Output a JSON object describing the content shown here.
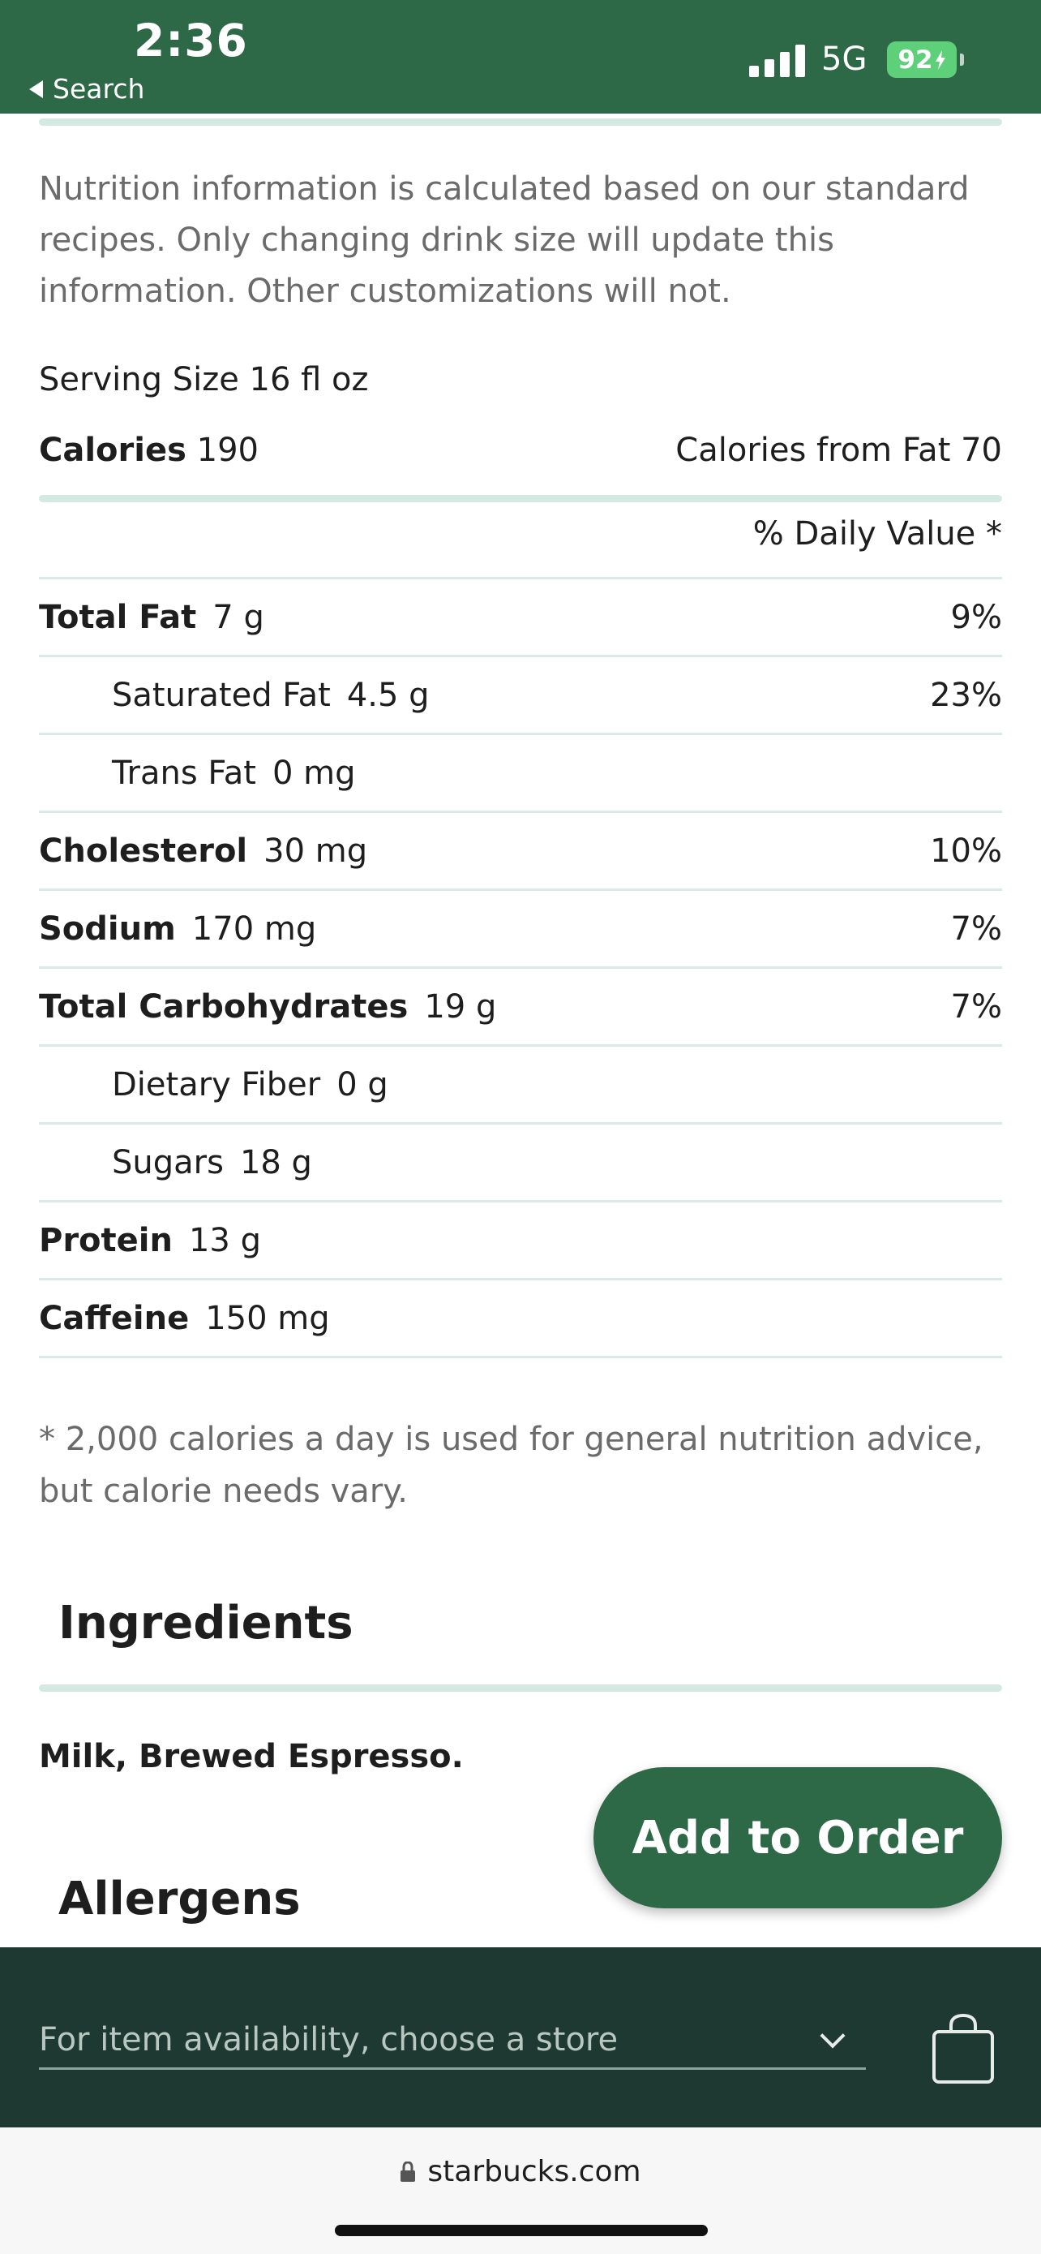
{
  "status_bar": {
    "time": "2:36",
    "back_label": "Search",
    "network": "5G",
    "battery": "92"
  },
  "nutrition": {
    "intro": "Nutrition information is calculated based on our standard recipes. Only changing drink size will update this information. Other customizations will not.",
    "serving_size_label": "Serving Size",
    "serving_size_value": "16 fl oz",
    "calories_label": "Calories",
    "calories_value": "190",
    "calories_from_fat": "Calories from Fat 70",
    "daily_value_header": "% Daily Value *",
    "rows": [
      {
        "name": "Total Fat",
        "amount": "7 g",
        "dv": "9%"
      },
      {
        "name": "Saturated Fat",
        "amount": "4.5 g",
        "dv": "23%"
      },
      {
        "name": "Trans Fat",
        "amount": "0 mg",
        "dv": ""
      },
      {
        "name": "Cholesterol",
        "amount": "30 mg",
        "dv": "10%"
      },
      {
        "name": "Sodium",
        "amount": "170 mg",
        "dv": "7%"
      },
      {
        "name": "Total Carbohydrates",
        "amount": "19 g",
        "dv": "7%"
      },
      {
        "name": "Dietary Fiber",
        "amount": "0 g",
        "dv": ""
      },
      {
        "name": "Sugars",
        "amount": "18 g",
        "dv": ""
      },
      {
        "name": "Protein",
        "amount": "13 g",
        "dv": ""
      },
      {
        "name": "Caffeine",
        "amount": "150 mg",
        "dv": ""
      }
    ],
    "footnote": "* 2,000 calories a day is used for general nutrition advice, but calorie needs vary."
  },
  "ingredients": {
    "title": "Ingredients",
    "text": "Milk, Brewed Espresso."
  },
  "allergens": {
    "title": "Allergens"
  },
  "cta": {
    "add_to_order": "Add to Order"
  },
  "store_bar": {
    "placeholder": "For item availability, choose a store"
  },
  "browser": {
    "url": "starbucks.com"
  },
  "colors": {
    "brand_green": "#2d6847",
    "dark_green": "#1e3932",
    "divider": "#d4e9e2"
  },
  "icons": [
    "back-arrow-icon",
    "signal-icon",
    "battery-icon",
    "chevron-down-icon",
    "shopping-bag-icon",
    "lock-icon"
  ]
}
